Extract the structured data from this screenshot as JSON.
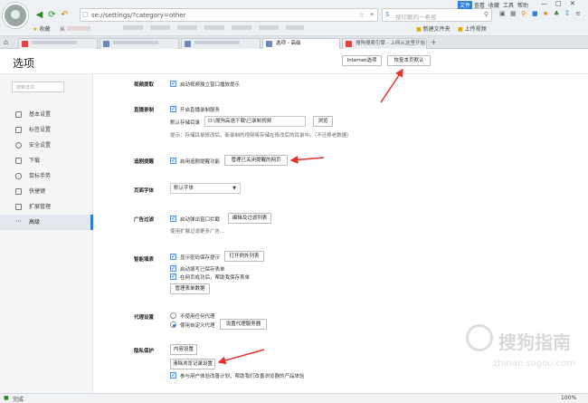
{
  "browser": {
    "address": "se://settings/?category=other",
    "search_placeholder": "按印痕的一希按",
    "menu": [
      "文件",
      "查看",
      "收藏",
      "工具",
      "帮助"
    ],
    "bookmarks": [
      "收藏",
      "从",
      "新建文件夹",
      "上传视频"
    ],
    "tabs": [
      {
        "label": "搜狗浏览器设置 - 上网从这里开始",
        "active": false
      },
      {
        "label": "选项 - 高级",
        "active": true
      },
      {
        "label": "搜狗搜索引擎 - 上网从这里开始",
        "active": false
      }
    ]
  },
  "page": {
    "title": "选项",
    "internet_options": "Internet选项",
    "restore_defaults": "恢复本页默认"
  },
  "sidebar": {
    "search_placeholder": "搜索选项",
    "items": [
      {
        "label": "基本设置",
        "icon": "gear-icon",
        "active": false
      },
      {
        "label": "标签设置",
        "icon": "tab-icon",
        "active": false
      },
      {
        "label": "安全设置",
        "icon": "shield-icon",
        "active": false
      },
      {
        "label": "下载",
        "icon": "download-icon",
        "active": false
      },
      {
        "label": "鼠标手势",
        "icon": "mouse-icon",
        "active": false
      },
      {
        "label": "快捷键",
        "icon": "keyboard-icon",
        "active": false
      },
      {
        "label": "扩展管理",
        "icon": "extension-icon",
        "active": false
      },
      {
        "label": "高级",
        "icon": "more-icon",
        "active": true
      }
    ]
  },
  "sections": {
    "video": {
      "header": "视频提取",
      "opt1": "启动视频独立窗口播放提示"
    },
    "live": {
      "header": "直播录制",
      "opt1": "开启直播录制服务",
      "dir_label": "默认存储目录",
      "dir_value": "D:\\搜狗高速下载\\已录制视频",
      "browse": "浏览",
      "tip": "提示：存储目录修改后，新录制的视频将存储在修改后的目录中。（不迁移老数据）"
    },
    "follow": {
      "header": "追剧提醒",
      "opt1": "启用追剧提醒功能",
      "manage": "管理已关闭提醒的网页"
    },
    "font": {
      "header": "页面字体",
      "value": "默认字体"
    },
    "ad": {
      "header": "广告过滤",
      "opt1": "启动弹出窗口拦截",
      "edit": "编辑及过滤列表",
      "note": "使用扩展过滤更多广告..."
    },
    "form": {
      "header": "智能填表",
      "opt1": "显示密码保存提示",
      "open_list": "打开例外列表",
      "opt2": "启动填写已保存表单",
      "opt3": "在网页成功后，帮助我保存表单",
      "manage": "管理表单数据"
    },
    "proxy": {
      "header": "代理设置",
      "opt1": "不使用任何代理",
      "opt2": "使用自定义代理",
      "set": "设置代理服务器"
    },
    "privacy": {
      "header": "隐私保护",
      "content": "内容设置",
      "clear": "清除浏览记录设置",
      "opt1": "参与用户体验改善计划，帮助我们改善浏览器的产品体验"
    }
  },
  "status": {
    "text": "完成",
    "zoom": "100%"
  },
  "watermark": {
    "brand": "搜狗指南",
    "url": "zhinan.sogou.com"
  },
  "colors": {
    "accent": "#2f7fd8",
    "arrow": "#e8312b"
  }
}
